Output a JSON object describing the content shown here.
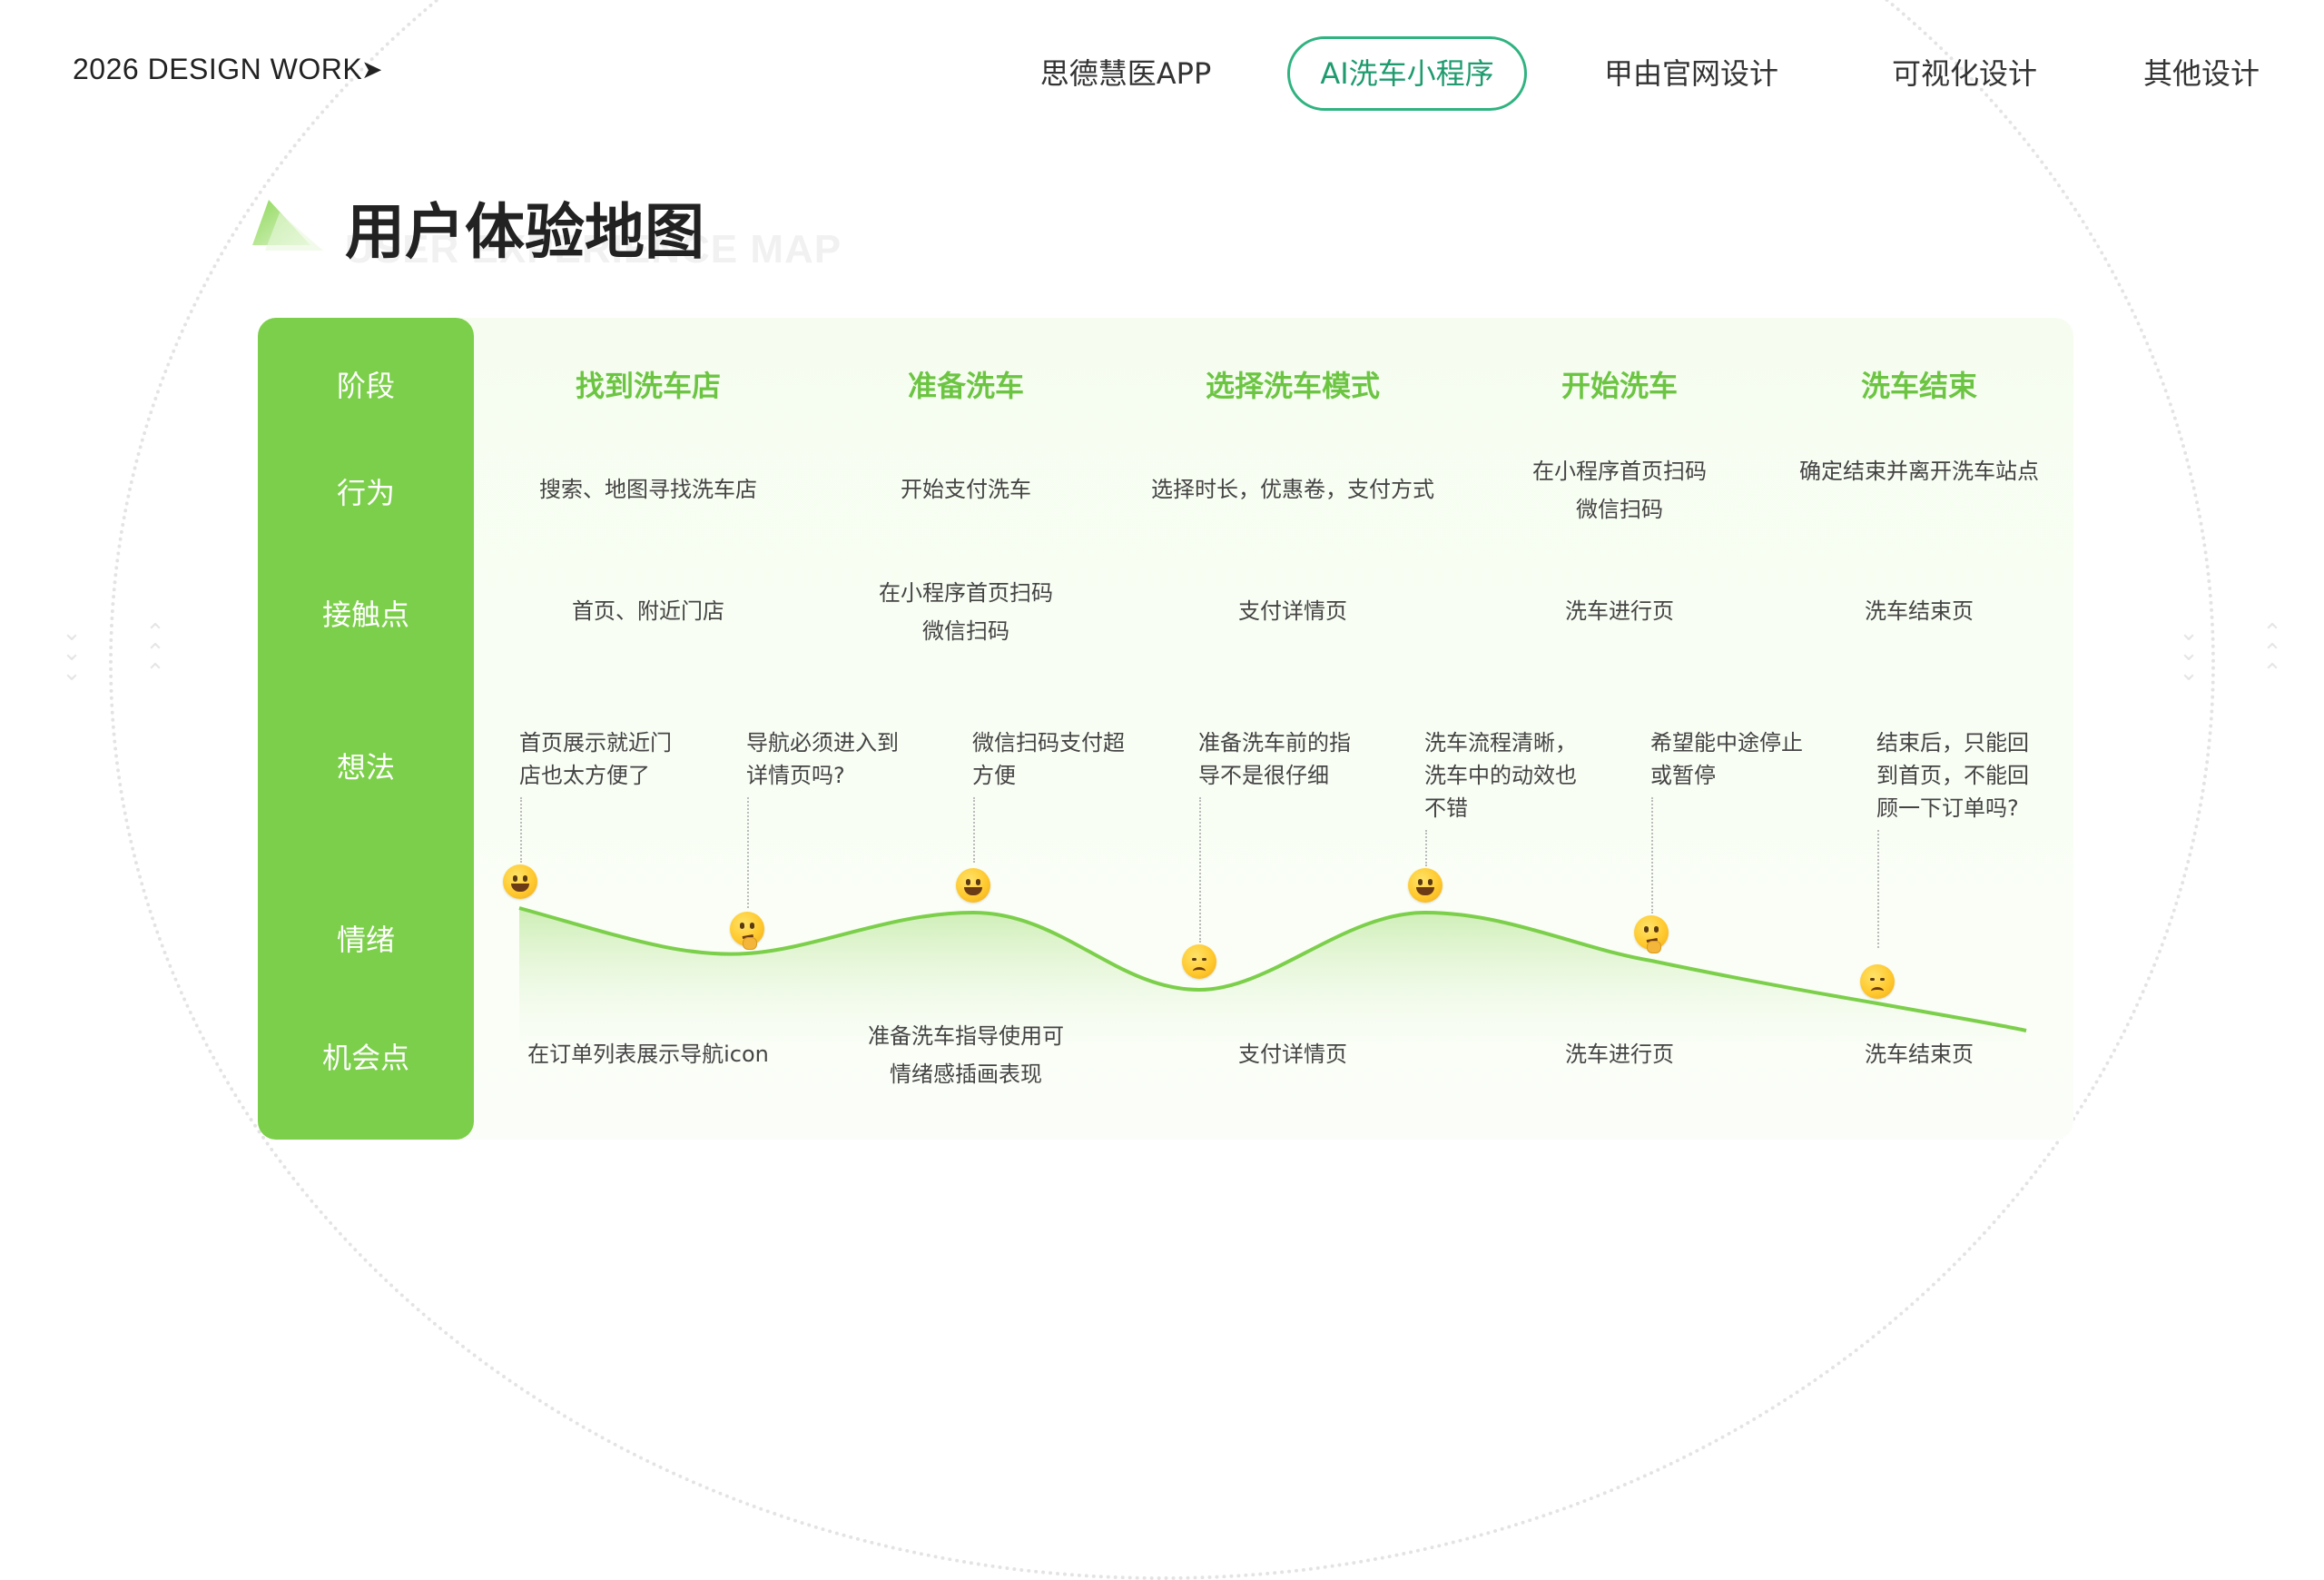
{
  "brand": {
    "label": "2026 DESIGN WORK",
    "arrow": "➤"
  },
  "nav": {
    "items": [
      {
        "label": "思德慧医APP"
      },
      {
        "label": "AI洗车小程序"
      },
      {
        "label": "甲由官网设计"
      },
      {
        "label": "可视化设计"
      },
      {
        "label": "其他设计"
      }
    ],
    "active_index": 1
  },
  "title": {
    "cn": "用户体验地图",
    "en": "USER EXPERIENCE MAP"
  },
  "colors": {
    "accent": "#7ccf4a",
    "nav_active": "#2fb380",
    "stage": "#6cc542"
  },
  "rows": {
    "stage": "阶段",
    "behavior": "行为",
    "touchpoint": "接触点",
    "thought": "想法",
    "emotion": "情绪",
    "opportunity": "机会点"
  },
  "stages": [
    "找到洗车店",
    "准备洗车",
    "选择洗车模式",
    "开始洗车",
    "洗车结束"
  ],
  "behaviors": [
    "搜索、地图寻找洗车店",
    "开始支付洗车",
    "选择时长，优惠卷，支付方式",
    "在小程序首页扫码\n微信扫码",
    "确定结束并离开洗车站点"
  ],
  "touchpoints": [
    "首页、附近门店",
    "在小程序首页扫码\n微信扫码",
    "支付详情页",
    "洗车进行页",
    "洗车结束页"
  ],
  "thoughts": [
    "首页展示就近门\n店也太方便了",
    "导航必须进入到\n详情页吗?",
    "微信扫码支付超\n方便",
    "准备洗车前的指\n导不是很仔细",
    "洗车流程清晰，\n洗车中的动效也\n不错",
    "希望能中途停止\n或暂停",
    "结束后，只能回\n到首页，不能回\n顾一下订单吗?"
  ],
  "emotions": [
    {
      "mood": "happy-face-icon"
    },
    {
      "mood": "thinking-face-icon"
    },
    {
      "mood": "happy-face-icon"
    },
    {
      "mood": "sad-face-icon"
    },
    {
      "mood": "happy-face-icon"
    },
    {
      "mood": "thinking-face-icon"
    },
    {
      "mood": "sad-face-icon"
    }
  ],
  "opportunities": [
    "在订单列表展示导航icon",
    "准备洗车指导使用可\n情绪感插画表现",
    "支付详情页",
    "洗车进行页",
    "洗车结束页"
  ]
}
